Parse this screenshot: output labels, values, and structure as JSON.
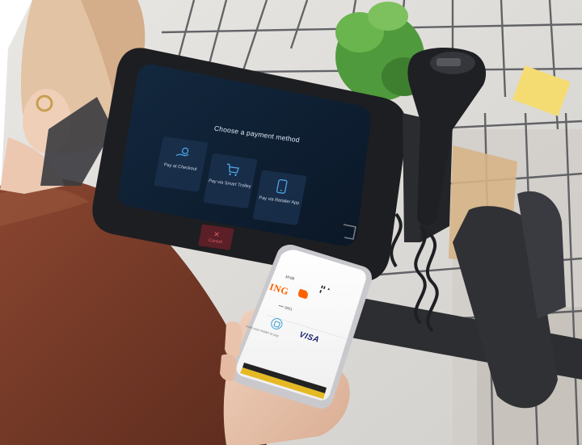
{
  "image": {
    "description_for_alt": "",
    "colors": {
      "background": "#ffffff",
      "screen_bg": "#0f2236",
      "tile_bg": "#1a304c",
      "cancel_bg": "#5a1f27",
      "cancel_fg": "#e05b63",
      "ing_orange": "#ff6200",
      "visa_blue": "#1a1f71",
      "sweater": "#6a3323",
      "device_black": "#2a2b2e"
    }
  },
  "tablet": {
    "title": "Choose a payment method",
    "options": [
      {
        "label": "Pay at Checkout",
        "icon": "hand-coin-icon"
      },
      {
        "label": "Pay via Smart Trolley",
        "icon": "cart-icon"
      },
      {
        "label": "Pay via Retailer App",
        "icon": "phone-app-icon"
      }
    ],
    "cancel": {
      "label": "Cancel",
      "icon": "close-icon"
    }
  },
  "phone": {
    "status_time": "10:08",
    "status_icons": "▮▮ ▲ ▮",
    "bank": "ING",
    "card_number": "•••• 3601",
    "visa": "VISA",
    "tap_text": "Hold near reader to pay"
  }
}
